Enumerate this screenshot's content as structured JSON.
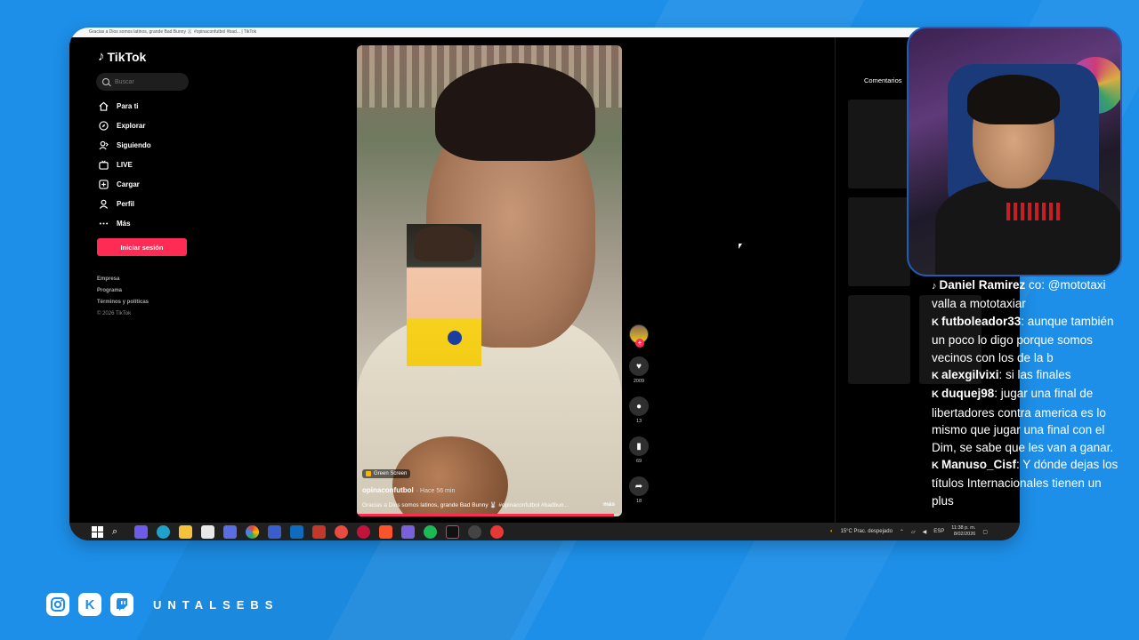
{
  "browser": {
    "tab_title": "Gracias a Dios somos latinos, grande Bad Bunny 🐰 #opinaconfutbol #bad... | TikTok"
  },
  "tiktok": {
    "logo": "TikTok",
    "search_placeholder": "Buscar",
    "nav": [
      {
        "label": "Para ti",
        "icon": "home-icon"
      },
      {
        "label": "Explorar",
        "icon": "compass-icon"
      },
      {
        "label": "Siguiendo",
        "icon": "following-icon"
      },
      {
        "label": "LIVE",
        "icon": "live-icon"
      },
      {
        "label": "Cargar",
        "icon": "upload-icon"
      },
      {
        "label": "Perfil",
        "icon": "profile-icon"
      },
      {
        "label": "Más",
        "icon": "more-icon"
      }
    ],
    "login_button": "Iniciar sesión",
    "footer": [
      "Empresa",
      "Programa",
      "Términos y políticas",
      "© 2026 TikTok"
    ]
  },
  "video": {
    "effect_badge": "Green Screen",
    "username": "opinaconfutbol",
    "time_ago": "· Hace 56 min",
    "caption": "Gracias a Dios somos latinos, grande Bad Bunny 🐰 #opinaconfutbol #badbun...",
    "more": "más",
    "progress": 0.97,
    "likes": "2009",
    "comments": "13",
    "saves": "69",
    "shares": "18"
  },
  "comments_panel": {
    "tab": "Comentarios"
  },
  "taskbar": {
    "weather": "15°C  Prac. despejado",
    "lang": "ESP",
    "time": "11:38 p. m.",
    "date": "8/02/2026"
  },
  "chat": [
    {
      "platform": "tiktok",
      "user": "Daniel Ramirez",
      "text": " co: @mototaxi valla a mototaxiar"
    },
    {
      "platform": "kick",
      "user": "futboleador33",
      "text": ": aunque también un poco lo digo porque somos vecinos con los de la b"
    },
    {
      "platform": "kick",
      "user": "alexgilvixi",
      "text": ": si las finales"
    },
    {
      "platform": "kick",
      "user": "duquej98",
      "text": ": jugar una final de libertadores contra america es lo mismo que jugar una final con el Dim, se sabe que les van a ganar."
    },
    {
      "platform": "kick",
      "user": "Manuso_Cisf",
      "text": ": Y dónde dejas los títulos Internacionales tienen un plus"
    }
  ],
  "branding": {
    "channel": "UNTALSEBS",
    "colors": {
      "background": "#1d8fe8",
      "tiktok_red": "#fe2c55"
    }
  }
}
